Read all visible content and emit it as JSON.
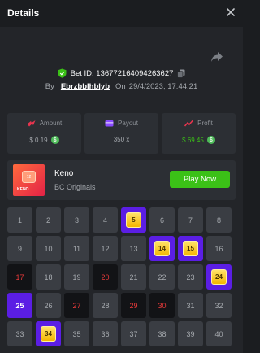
{
  "header": {
    "title": "Details",
    "close_icon": "close-icon"
  },
  "bet": {
    "id_label": "Bet ID: 136772164094263627",
    "by_label": "By",
    "username": "Ebrzbblhblyb",
    "on_label": "On",
    "datetime": "29/4/2023, 17:44:21"
  },
  "stats": {
    "amount": {
      "label": "Amount",
      "value": "$ 0.19",
      "icon": "coins-icon"
    },
    "payout": {
      "label": "Payout",
      "value": "350 x",
      "icon": "wallet-icon"
    },
    "profit": {
      "label": "Profit",
      "value": "$ 69.45",
      "icon": "chart-up-icon"
    }
  },
  "game": {
    "name": "Keno",
    "provider": "BC Originals",
    "thumb_number": "12",
    "thumb_text": "KENO",
    "play_label": "Play Now"
  },
  "board": {
    "numbers": [
      "1",
      "2",
      "3",
      "4",
      "5",
      "6",
      "7",
      "8",
      "9",
      "10",
      "11",
      "12",
      "13",
      "14",
      "15",
      "16",
      "17",
      "18",
      "19",
      "20",
      "21",
      "22",
      "23",
      "24",
      "25",
      "26",
      "27",
      "28",
      "29",
      "30",
      "31",
      "32",
      "33",
      "34",
      "35",
      "36",
      "37",
      "38",
      "39",
      "40"
    ],
    "hits": [
      "5",
      "14",
      "15",
      "24",
      "34"
    ],
    "picked": [
      "25"
    ],
    "drawn": [
      "17",
      "20",
      "27",
      "29",
      "30"
    ]
  },
  "colors": {
    "accent_green": "#3bc117",
    "pick_purple": "#5b1ee4",
    "drawn_red": "#ea3a3a"
  }
}
